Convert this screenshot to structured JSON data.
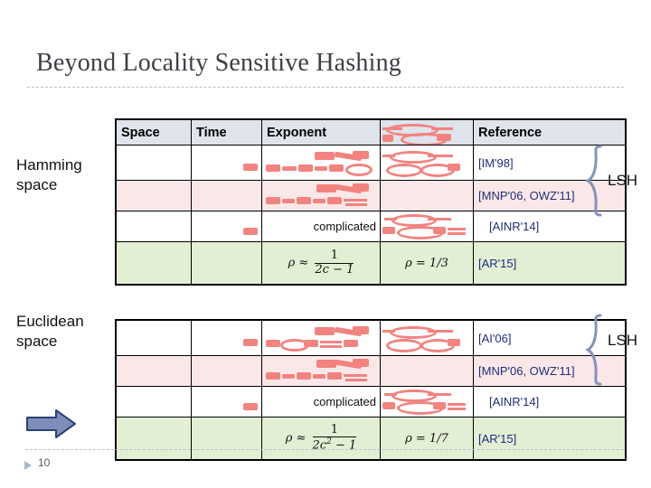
{
  "slide": {
    "title": "Beyond Locality Sensitive Hashing",
    "page_number": "10"
  },
  "labels": {
    "hamming_line1": "Hamming",
    "hamming_line2": "space",
    "euclidean_line1": "Euclidean",
    "euclidean_line2": "space",
    "lsh_top": "LSH",
    "lsh_bottom": "LSH"
  },
  "table_headers": {
    "space": "Space",
    "time": "Time",
    "exponent": "Exponent",
    "rho": "",
    "reference": "Reference"
  },
  "hamming_table": {
    "rows": [
      {
        "space": "",
        "time": "",
        "exponent": "",
        "rho": "",
        "reference": "[IM'98]",
        "row_style": "row-white",
        "redacted": true
      },
      {
        "space": "",
        "time": "",
        "exponent": "",
        "rho": "",
        "reference": "[MNP'06, OWZ'11]",
        "row_style": "row-pink",
        "redacted": true
      },
      {
        "space": "",
        "time": "",
        "exponent": "complicated",
        "rho": "",
        "reference": "[AINR'14]",
        "row_style": "row-white",
        "redacted": true
      },
      {
        "space": "",
        "time": "",
        "exponent_formula": "ρ ≈ 1/(2c − 1)",
        "exponent_num": "1",
        "exponent_den": "2c − 1",
        "rho": "ρ = 1/3",
        "reference": "[AR'15]",
        "row_style": "row-green",
        "redacted": false
      }
    ]
  },
  "euclidean_table": {
    "rows": [
      {
        "space": "",
        "time": "",
        "exponent": "",
        "rho": "",
        "reference": "[AI'06]",
        "row_style": "row-white",
        "redacted": true
      },
      {
        "space": "",
        "time": "",
        "exponent": "",
        "rho": "",
        "reference": "[MNP'06, OWZ'11]",
        "row_style": "row-pink",
        "redacted": true
      },
      {
        "space": "",
        "time": "",
        "exponent": "complicated",
        "rho": "",
        "reference": "[AINR'14]",
        "row_style": "row-white",
        "redacted": true
      },
      {
        "space": "",
        "time": "",
        "exponent_formula": "ρ ≈ 1/(2c² − 1)",
        "exponent_num": "1",
        "exponent_den_base": "2c",
        "exponent_den_exp": "2",
        "exponent_den_tail": " − 1",
        "rho": "ρ = 1/7",
        "reference": "[AR'15]",
        "row_style": "row-green",
        "redacted": false
      }
    ]
  },
  "formula_symbols": {
    "rho_approx": "ρ ≈",
    "rho_eq_third": "ρ = 1/3",
    "rho_eq_seventh": "ρ = 1/7"
  },
  "colors": {
    "header_bg": "#dfe3ec",
    "row_pink": "#fae8e8",
    "row_green": "#e3efd5",
    "redaction": "#f2837f",
    "reference_text": "#1f2d7a",
    "title_text": "#3f3f46",
    "brace": "#8494b8",
    "arrow": "#7e8dba"
  }
}
